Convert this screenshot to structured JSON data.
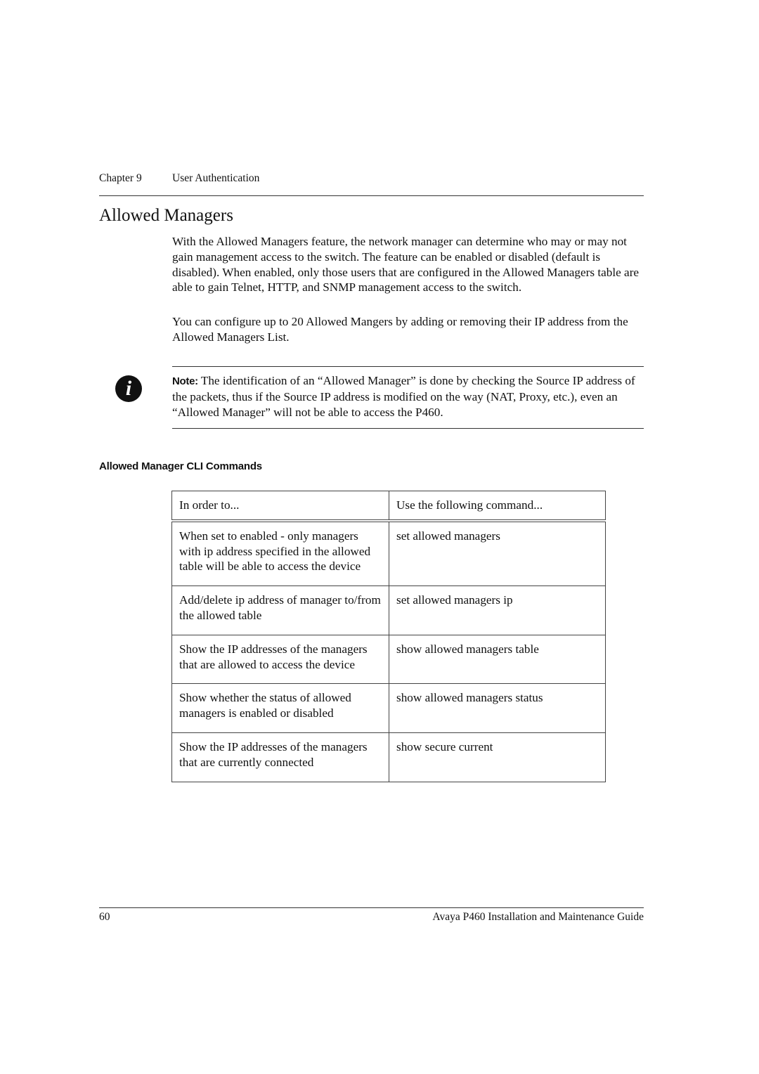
{
  "header": {
    "chapter": "Chapter 9",
    "section": "User Authentication"
  },
  "title": "Allowed Managers",
  "paragraphs": [
    "With the Allowed Managers feature, the network manager can determine who may or may not gain management access to the switch. The feature can be enabled or disabled (default is disabled). When enabled, only those users that are configured in the Allowed Managers table are able to gain Telnet, HTTP, and SNMP management access to the switch.",
    "You can configure up to 20 Allowed Mangers by adding or removing their IP address from the Allowed Managers List."
  ],
  "note": {
    "icon": "info-icon",
    "label": "Note:",
    "text": " The identification of an “Allowed Manager” is done by checking the Source IP address of the packets, thus if the Source IP address is modified on the way (NAT, Proxy, etc.), even an “Allowed Manager” will not be able to access the P460."
  },
  "subheading": "Allowed Manager CLI Commands",
  "table": {
    "headers": [
      "In order to...",
      "Use the following command..."
    ],
    "rows": [
      [
        "When set to enabled - only managers with ip address specified in the allowed table will be able to access the device",
        "set allowed managers"
      ],
      [
        "Add/delete ip address of manager to/from the allowed table",
        "set allowed managers ip"
      ],
      [
        "Show the IP addresses of the managers that are allowed to access the device",
        "show allowed managers table"
      ],
      [
        "Show whether the status of allowed managers is enabled or disabled",
        "show allowed managers status"
      ],
      [
        "Show the IP addresses of the managers that are currently connected",
        "show secure current"
      ]
    ]
  },
  "footer": {
    "page_number": "60",
    "book_title": "Avaya P460 Installation and Maintenance Guide"
  }
}
